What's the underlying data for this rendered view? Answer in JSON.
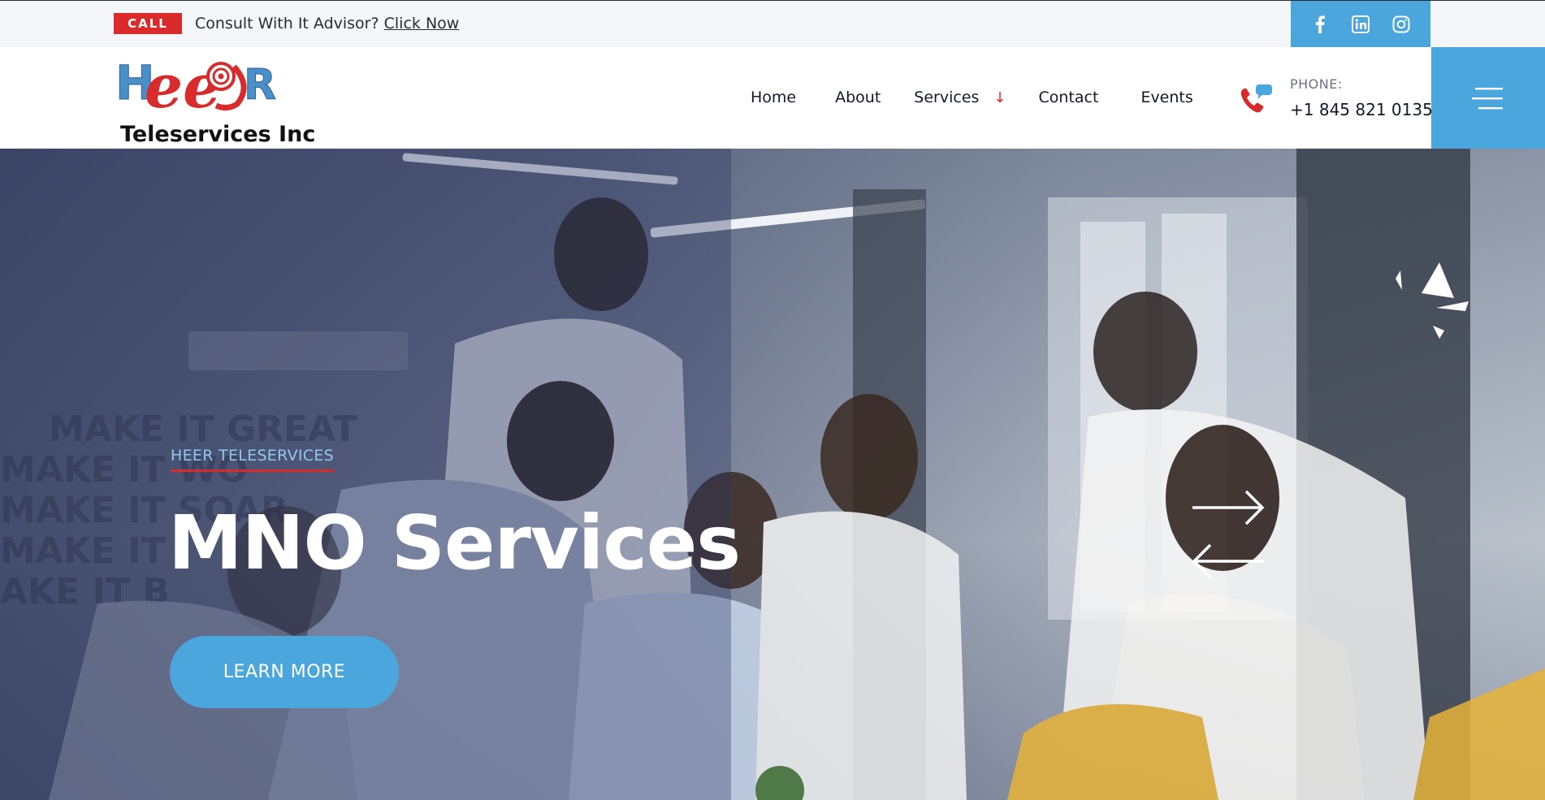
{
  "topbar": {
    "call_badge": "CALL",
    "consult_text": "Consult With It Advisor?",
    "consult_link": "Click Now",
    "social": [
      {
        "icon": "facebook-icon"
      },
      {
        "icon": "linkedin-icon"
      },
      {
        "icon": "instagram-icon"
      }
    ]
  },
  "header": {
    "logo_text": "Teleservices Inc",
    "nav": [
      {
        "label": "Home"
      },
      {
        "label": "About"
      },
      {
        "label": "Services",
        "arrow": "↓"
      },
      {
        "label": "Contact"
      },
      {
        "label": "Events"
      }
    ],
    "phone_label": "PHONE:",
    "phone_number": "+1 845 821 0135"
  },
  "hero": {
    "eyebrow": "HEER TELESERVICES",
    "title": "MNO Services",
    "button": "LEARN MORE"
  },
  "colors": {
    "accent_blue": "#4aa6dc",
    "brand_red": "#d92b2b",
    "text_dark": "#111827"
  }
}
